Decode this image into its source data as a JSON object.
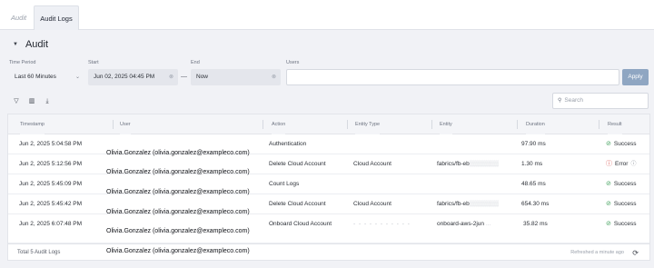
{
  "tabs": [
    {
      "label": "Audit"
    },
    {
      "label": "Audit Logs"
    }
  ],
  "section": {
    "title": "Audit"
  },
  "filters": {
    "time_period": {
      "label": "Time Period",
      "value": "Last 60 Minutes"
    },
    "start": {
      "label": "Start",
      "value": "Jun 02, 2025 04:45 PM"
    },
    "end": {
      "label": "End",
      "value": "Now"
    },
    "users": {
      "label": "Users",
      "value": ""
    },
    "apply_label": "Apply"
  },
  "toolbar": {
    "search_placeholder": "Search"
  },
  "table": {
    "columns": [
      "Timestamp",
      "User",
      "Action",
      "Entity Type",
      "Entity",
      "Duration",
      "Result"
    ],
    "rows": [
      {
        "timestamp": "Jun 2, 2025 5:04:58 PM",
        "action": "Authentication",
        "entity_type": "",
        "entity": "",
        "duration": "97.90 ms",
        "result": "Success"
      },
      {
        "timestamp": "Jun 2, 2025 5:12:56 PM",
        "action": "Delete Cloud Account",
        "entity_type": "Cloud Account",
        "entity": "fabrics/fb-eb",
        "duration": "1.30 ms",
        "result": "Error"
      },
      {
        "timestamp": "Jun 2, 2025 5:45:09 PM",
        "action": "Count Logs",
        "entity_type": "",
        "entity": "",
        "duration": "48.65 ms",
        "result": "Success"
      },
      {
        "timestamp": "Jun 2, 2025 5:45:42 PM",
        "action": "Delete Cloud Account",
        "entity_type": "Cloud Account",
        "entity": "fabrics/fb-eb",
        "duration": "654.30 ms",
        "result": "Success"
      },
      {
        "timestamp": "Jun 2, 2025 6:07:48 PM",
        "action": "Onboard Cloud Account",
        "entity_type": "",
        "entity": "onboard-aws-2jun",
        "duration": "35.82 ms",
        "result": "Success"
      }
    ],
    "user_labels": [
      "Olivia.Gonzalez (olivia.gonzalez@exampleco.com)",
      "Olivia.Gonzalez (olivia.gonzalez@exampleco.com)",
      "Olivia.Gonzalez (olivia.gonzalez@exampleco.com)",
      "Olivia.Gonzalez (olivia.gonzalez@exampleco.com)",
      "Olivia.Gonzalez (olivia.gonzalez@exampleco.com)",
      "Olivia.Gonzalez (olivia.gonzalez@exampleco.com)"
    ]
  },
  "footer": {
    "total": "Total 5 Audit Logs",
    "refreshed": "Refreshed a minute ago"
  },
  "colors": {
    "success": "#4aa564",
    "error": "#d9534f",
    "apply": "#8fa6c2"
  }
}
